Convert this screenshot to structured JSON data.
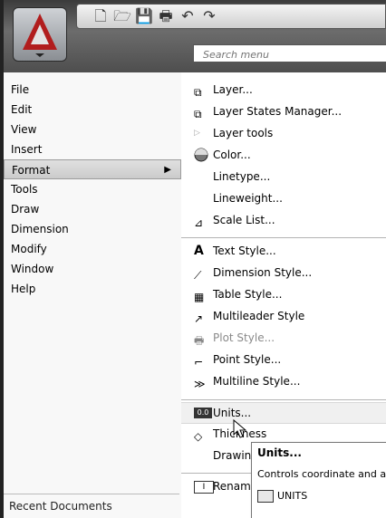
{
  "search": {
    "placeholder": "Search menu"
  },
  "menu": {
    "items": [
      {
        "label": "File",
        "key": "F"
      },
      {
        "label": "Edit",
        "key": "E"
      },
      {
        "label": "View",
        "key": "V"
      },
      {
        "label": "Insert",
        "key": "I"
      },
      {
        "label": "Format",
        "key": "o",
        "selected": true
      },
      {
        "label": "Tools",
        "key": "T"
      },
      {
        "label": "Draw",
        "key": "D"
      },
      {
        "label": "Dimension",
        "key": "n"
      },
      {
        "label": "Modify",
        "key": "M"
      },
      {
        "label": "Window",
        "key": "W"
      },
      {
        "label": "Help",
        "key": "H"
      }
    ],
    "recent_label": "Recent Documents"
  },
  "submenu": {
    "items": [
      {
        "label": "Layer...",
        "icon": "layer-icon"
      },
      {
        "label": "Layer States Manager...",
        "icon": "layer-states-icon"
      },
      {
        "label": "Layer tools",
        "icon": "submenu-arrow-icon"
      },
      {
        "label": "Color...",
        "icon": "color-icon"
      },
      {
        "label": "Linetype...",
        "icon": "none"
      },
      {
        "label": "Lineweight...",
        "icon": "none"
      },
      {
        "label": "Scale List...",
        "icon": "scale-list-icon"
      },
      {
        "label": "Text Style...",
        "icon": "text-style-icon"
      },
      {
        "label": "Dimension Style...",
        "icon": "dimension-style-icon"
      },
      {
        "label": "Table Style...",
        "icon": "table-style-icon"
      },
      {
        "label": "Multileader Style",
        "icon": "multileader-style-icon"
      },
      {
        "label": "Plot Style...",
        "icon": "plot-style-icon",
        "disabled": true
      },
      {
        "label": "Point Style...",
        "icon": "point-style-icon"
      },
      {
        "label": "Multiline Style...",
        "icon": "multiline-style-icon"
      },
      {
        "label": "Units...",
        "icon": "units-icon",
        "highlighted": true
      },
      {
        "label": "Thickness",
        "icon": "thickness-icon"
      },
      {
        "label": "Drawing Limits",
        "icon": "none"
      },
      {
        "label": "Rename...",
        "icon": "rename-icon"
      }
    ]
  },
  "tooltip": {
    "title": "Units...",
    "description": "Controls coordinate and angle display formats and precision",
    "command": "UNITS"
  }
}
